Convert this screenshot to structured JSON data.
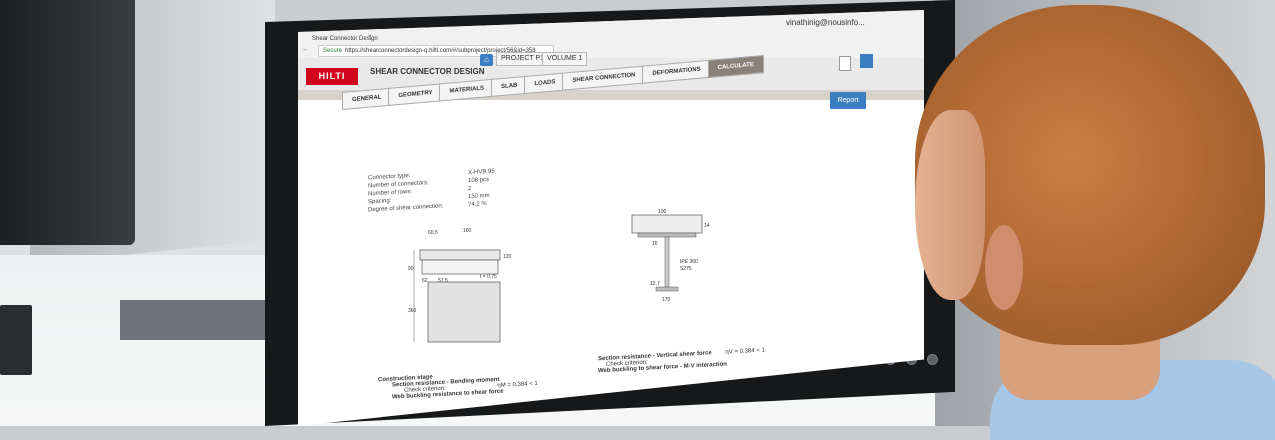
{
  "browser": {
    "tab_title": "Shear Connector Design",
    "tab_close": "×",
    "nav_buttons": "← → C",
    "secure_label": "Secure",
    "url": "https://shearconnectordesign-q.hilti.com/#/subproject/project/56&id=358",
    "user": "vinathinig@nousinfo..."
  },
  "app": {
    "logo_text": "HILTI",
    "title": "SHEAR CONNECTOR DESIGN",
    "home_icon": "⌂",
    "breadcrumbs": [
      "PROJECT P1",
      "VOLUME 1"
    ],
    "save_icon": "💾",
    "report_label": "Report"
  },
  "steps": [
    "GENERAL",
    "GEOMETRY",
    "MATERIALS",
    "SLAB",
    "LOADS",
    "SHEAR CONNECTION",
    "DEFORMATIONS",
    "CALCULATE"
  ],
  "active_step": "CALCULATE",
  "summary": [
    {
      "label": "Connector type:",
      "value": "X-HVB 95"
    },
    {
      "label": "Number of connectors:",
      "value": "108 pcs"
    },
    {
      "label": "Number of rows:",
      "value": "2"
    },
    {
      "label": "Spacing:",
      "value": "150 mm"
    },
    {
      "label": "Degree of shear connection:",
      "value": "74.2 %"
    }
  ],
  "drawing_left": {
    "dims": [
      "60.5",
      "160",
      "120",
      "90",
      "62",
      "57.5",
      "t = 0.75",
      "360"
    ]
  },
  "drawing_right": {
    "dims": [
      "100",
      "14",
      "10",
      "IPE 360",
      "S275",
      "12.7",
      "170"
    ]
  },
  "results": {
    "construction_stage": "Construction stage",
    "bending_title": "Section resistance - Bending moment",
    "bending_criterion": "Check criterion:",
    "bending_value": "= 0.384 < 1",
    "bending_symbol": "ηM",
    "web_buckling_title": "Web buckling resistance to shear force",
    "vertical_title": "Section resistance - Vertical shear force",
    "vertical_criterion": "Check criterion:",
    "vertical_symbol": "ηV",
    "vertical_value": "= 0.384 < 1",
    "web_interaction_title": "Web buckling to shear force - M-V interaction"
  },
  "colors": {
    "hilti_red": "#d2051e",
    "accent_blue": "#3a7fc1",
    "active_tab": "#8a8178",
    "shirt": "#a7c7e6",
    "hair": "#b36a34"
  }
}
